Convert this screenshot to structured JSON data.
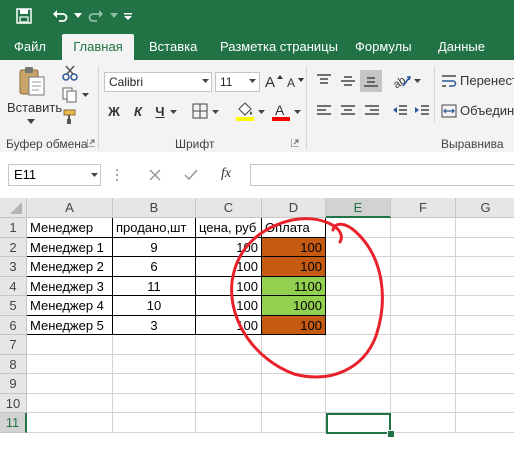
{
  "ribbon_tabs": [
    "Файл",
    "Главная",
    "Вставка",
    "Разметка страницы",
    "Формулы",
    "Данные"
  ],
  "active_tab": "Главная",
  "clipboard": {
    "paste_label": "Вставить",
    "group": "Буфер обмена"
  },
  "font": {
    "name": "Calibri",
    "size": "11",
    "group": "Шрифт",
    "bold": "Ж",
    "italic": "К",
    "underline": "Ч"
  },
  "alignment": {
    "wrap_label": "Перенест",
    "merge_label": "Объедин",
    "group": "Выравнива"
  },
  "formula_bar": {
    "name_box": "E11",
    "fx": "fx",
    "value": ""
  },
  "columns": [
    "A",
    "B",
    "C",
    "D",
    "E",
    "F",
    "G"
  ],
  "rows": [
    "1",
    "2",
    "3",
    "4",
    "5",
    "6",
    "7",
    "8",
    "9",
    "10",
    "11"
  ],
  "selected_cell": "E11",
  "table": {
    "headers": [
      "Менеджер",
      "продано,шт",
      "цена, руб",
      "Оплата"
    ],
    "rows": [
      [
        "Менеджер 1",
        "9",
        "100",
        "100"
      ],
      [
        "Менеджер 2",
        "6",
        "100",
        "100"
      ],
      [
        "Менеджер 3",
        "11",
        "100",
        "1100"
      ],
      [
        "Менеджер 4",
        "10",
        "100",
        "1000"
      ],
      [
        "Менеджер 5",
        "3",
        "100",
        "100"
      ]
    ],
    "payment_colors": [
      "#c55a11",
      "#c55a11",
      "#92d050",
      "#92d050",
      "#c55a11"
    ]
  },
  "colors": {
    "excel_green": "#217346",
    "annotation_red": "#e8212b"
  }
}
